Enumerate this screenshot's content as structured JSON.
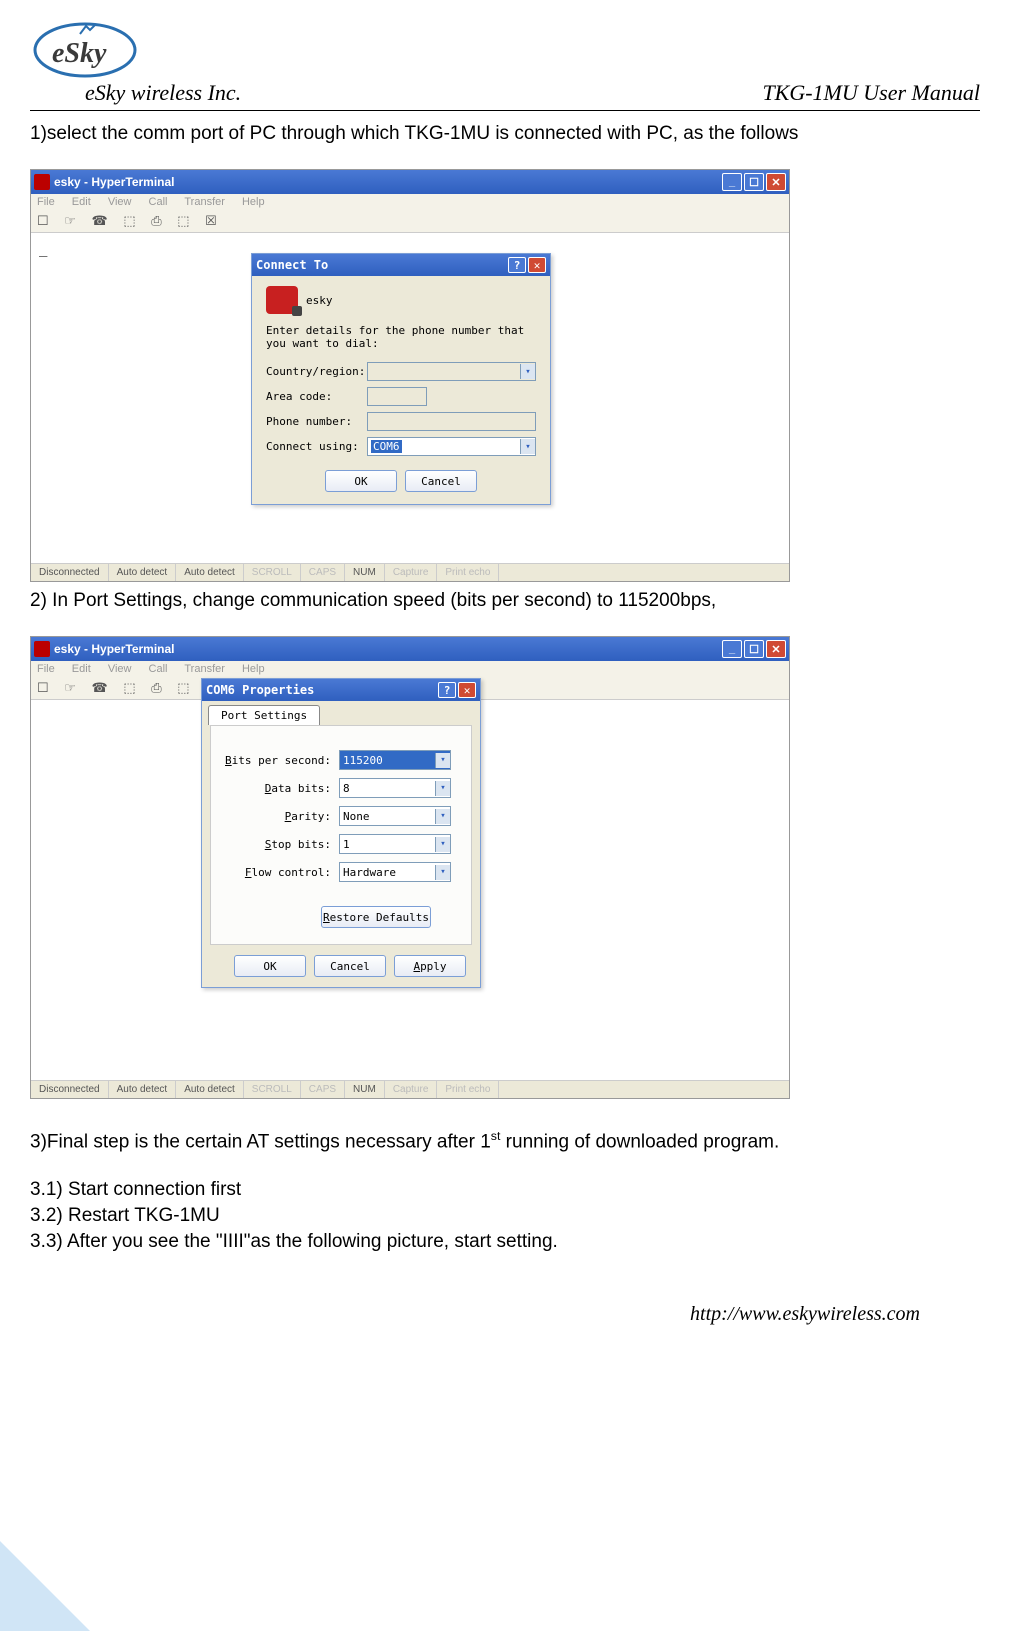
{
  "header": {
    "company": "eSky wireless Inc.",
    "doc_title": "TKG-1MU User Manual"
  },
  "intro": {
    "step1": "1)select the comm port of PC through which TKG-1MU is connected with PC, as the follows",
    "step2": "2) In Port Settings, change communication speed (bits per second) to 115200bps,",
    "step3_prefix": "3)Final step is the certain AT settings necessary after 1",
    "step3_sup": "st",
    "step3_suffix": " running of downloaded program.",
    "step31": "3.1) Start connection first",
    "step32": "3.2) Restart TKG-1MU",
    "step33": "3.3) After you see the \"IIII\"as the following picture, start setting."
  },
  "ht": {
    "title": "esky - HyperTerminal",
    "menus": [
      "File",
      "Edit",
      "View",
      "Call",
      "Transfer",
      "Help"
    ],
    "toolbar_glyphs": "☐ ☞  ☎ ⬚   ⎙ ⬚  ☒",
    "cursor": "_",
    "status": {
      "conn": "Disconnected",
      "detect1": "Auto detect",
      "detect2": "Auto detect",
      "scroll": "SCROLL",
      "caps": "CAPS",
      "num": "NUM",
      "capture": "Capture",
      "print": "Print echo"
    }
  },
  "connect_dialog": {
    "title": "Connect To",
    "name": "esky",
    "instruction": "Enter details for the phone number that you want to dial:",
    "labels": {
      "country": "Country/region:",
      "area": "Area code:",
      "phone": "Phone number:",
      "using": "Connect using:"
    },
    "values": {
      "using": "COM6"
    },
    "buttons": {
      "ok": "OK",
      "cancel": "Cancel"
    }
  },
  "props_dialog": {
    "title": "COM6 Properties",
    "tab": "Port Settings",
    "labels": {
      "bps": "Bits per second:",
      "data": "Data bits:",
      "parity": "Parity:",
      "stop": "Stop bits:",
      "flow": "Flow control:"
    },
    "values": {
      "bps": "115200",
      "data": "8",
      "parity": "None",
      "stop": "1",
      "flow": "Hardware"
    },
    "restore": "Restore Defaults",
    "buttons": {
      "ok": "OK",
      "cancel": "Cancel",
      "apply": "Apply"
    }
  },
  "footer": {
    "url": "http://www.eskywireless.com"
  }
}
